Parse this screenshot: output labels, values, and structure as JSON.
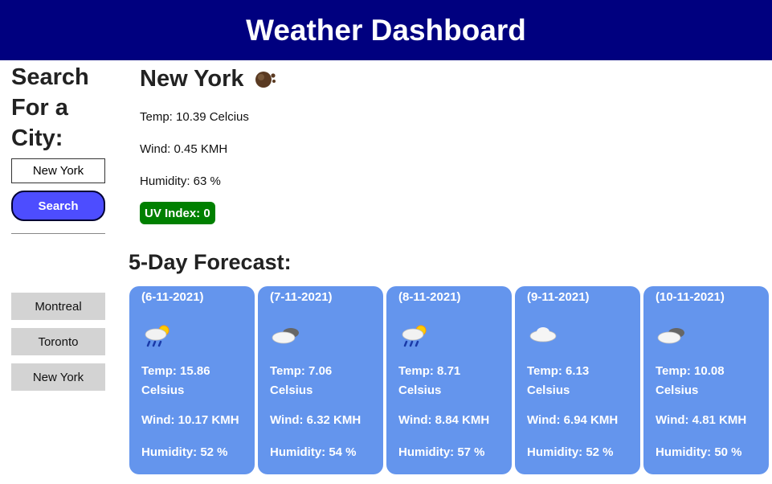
{
  "header": {
    "title": "Weather Dashboard"
  },
  "sidebar": {
    "heading": "Search For a City:",
    "input_value": "New York",
    "search_label": "Search",
    "history": [
      "Montreal",
      "Toronto",
      "New York"
    ]
  },
  "current": {
    "city": "New York",
    "icon": "rain-cloud-icon",
    "temp": "Temp: 10.39 Celcius",
    "wind": "Wind: 0.45 KMH",
    "humidity": "Humidity: 63 %",
    "uv": "UV Index: 0"
  },
  "forecast": {
    "title": "5-Day Forecast:",
    "days": [
      {
        "date": "(6-11-2021)",
        "icon": "sun-rain-cloud-icon",
        "temp": "Temp: 15.86 Celsius",
        "wind": "Wind: 10.17 KMH",
        "humidity": "Humidity: 52 %"
      },
      {
        "date": "(7-11-2021)",
        "icon": "overcast-clouds-icon",
        "temp": "Temp: 7.06 Celsius",
        "wind": "Wind: 6.32 KMH",
        "humidity": "Humidity: 54 %"
      },
      {
        "date": "(8-11-2021)",
        "icon": "sun-rain-cloud-icon",
        "temp": "Temp: 8.71 Celsius",
        "wind": "Wind: 8.84 KMH",
        "humidity": "Humidity: 57 %"
      },
      {
        "date": "(9-11-2021)",
        "icon": "cloud-icon",
        "temp": "Temp: 6.13 Celsius",
        "wind": "Wind: 6.94 KMH",
        "humidity": "Humidity: 52 %"
      },
      {
        "date": "(10-11-2021)",
        "icon": "overcast-clouds-icon",
        "temp": "Temp: 10.08 Celsius",
        "wind": "Wind: 4.81 KMH",
        "humidity": "Humidity: 50 %"
      }
    ]
  },
  "colors": {
    "header_bg": "#00007f",
    "search_button": "#4d4dff",
    "uv_badge": "#008000",
    "forecast_card": "#6495ed",
    "history_item": "#d3d3d3"
  }
}
